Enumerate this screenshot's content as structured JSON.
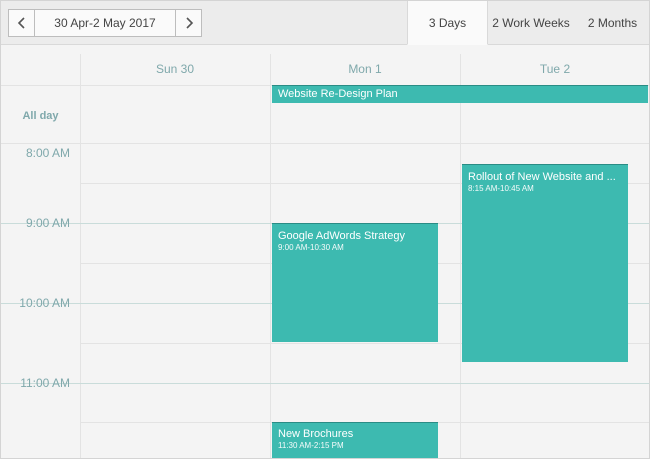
{
  "toolbar": {
    "prev_icon": "chevron-left-icon",
    "next_icon": "chevron-right-icon",
    "date_range": "30 Apr-2 May 2017",
    "views": [
      {
        "label": "3 Days",
        "active": true
      },
      {
        "label": "2 Work Weeks",
        "active": false
      },
      {
        "label": "2 Months",
        "active": false
      }
    ]
  },
  "scheduler": {
    "days": [
      "Sun 30",
      "Mon 1",
      "Tue 2"
    ],
    "all_day_label": "All day",
    "times": [
      "8:00 AM",
      "9:00 AM",
      "10:00 AM",
      "11:00 AM"
    ]
  },
  "events": {
    "allday": {
      "title": "Website Re-Design Plan"
    },
    "rollout": {
      "title": "Rollout of New Website and ...",
      "time": "8:15 AM-10:45 AM"
    },
    "adwords": {
      "title": "Google AdWords Strategy",
      "time": "9:00 AM-10:30 AM"
    },
    "brochures": {
      "title": "New Brochures",
      "time": "11:30 AM-2:15 PM"
    }
  },
  "colors": {
    "event": "#3dbab0",
    "header_text": "#7fa8ab",
    "background": "#f4f4f4"
  }
}
